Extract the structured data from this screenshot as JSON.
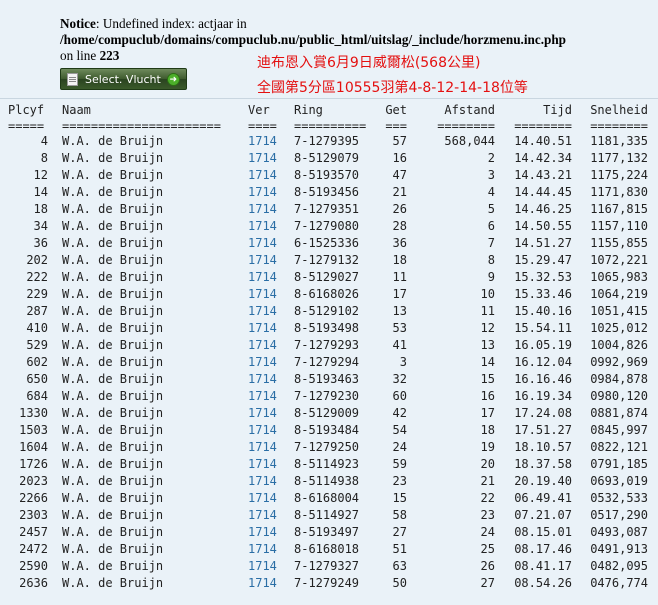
{
  "notice": {
    "label": "Notice",
    "message": ": Undefined index: actjaar in",
    "path": "/home/compuclub/domains/compuclub.nu/public_html/uitslag/_include/horzmenu.inc.php",
    "on_line": "on line",
    "line_no": "223"
  },
  "select_button": {
    "label": "Select. Vlucht"
  },
  "chinese": {
    "line1": "迪布恩入賞6月9日威爾松(568公里)",
    "line2": "全國第5分區10555羽第4-8-12-14-18位等"
  },
  "columns": [
    "Plcyf",
    "Naam",
    "Ver",
    "Ring",
    "Get",
    "Afstand",
    "Tijd",
    "Snelheid"
  ],
  "underlines": [
    "=====",
    "======================",
    "====",
    "==========",
    "===",
    "========",
    "========",
    "========"
  ],
  "rows": [
    [
      "4",
      "W.A. de Bruijn",
      "1714",
      "7-1279395",
      "57",
      "568,044",
      "14.40.51",
      "1181,335"
    ],
    [
      "8",
      "W.A. de Bruijn",
      "1714",
      "8-5129079",
      "16",
      "2",
      "14.42.34",
      "1177,132"
    ],
    [
      "12",
      "W.A. de Bruijn",
      "1714",
      "8-5193570",
      "47",
      "3",
      "14.43.21",
      "1175,224"
    ],
    [
      "14",
      "W.A. de Bruijn",
      "1714",
      "8-5193456",
      "21",
      "4",
      "14.44.45",
      "1171,830"
    ],
    [
      "18",
      "W.A. de Bruijn",
      "1714",
      "7-1279351",
      "26",
      "5",
      "14.46.25",
      "1167,815"
    ],
    [
      "34",
      "W.A. de Bruijn",
      "1714",
      "7-1279080",
      "28",
      "6",
      "14.50.55",
      "1157,110"
    ],
    [
      "36",
      "W.A. de Bruijn",
      "1714",
      "6-1525336",
      "36",
      "7",
      "14.51.27",
      "1155,855"
    ],
    [
      "202",
      "W.A. de Bruijn",
      "1714",
      "7-1279132",
      "18",
      "8",
      "15.29.47",
      "1072,221"
    ],
    [
      "222",
      "W.A. de Bruijn",
      "1714",
      "8-5129027",
      "11",
      "9",
      "15.32.53",
      "1065,983"
    ],
    [
      "229",
      "W.A. de Bruijn",
      "1714",
      "8-6168026",
      "17",
      "10",
      "15.33.46",
      "1064,219"
    ],
    [
      "287",
      "W.A. de Bruijn",
      "1714",
      "8-5129102",
      "13",
      "11",
      "15.40.16",
      "1051,415"
    ],
    [
      "410",
      "W.A. de Bruijn",
      "1714",
      "8-5193498",
      "53",
      "12",
      "15.54.11",
      "1025,012"
    ],
    [
      "529",
      "W.A. de Bruijn",
      "1714",
      "7-1279293",
      "41",
      "13",
      "16.05.19",
      "1004,826"
    ],
    [
      "602",
      "W.A. de Bruijn",
      "1714",
      "7-1279294",
      "3",
      "14",
      "16.12.04",
      "0992,969"
    ],
    [
      "650",
      "W.A. de Bruijn",
      "1714",
      "8-5193463",
      "32",
      "15",
      "16.16.46",
      "0984,878"
    ],
    [
      "684",
      "W.A. de Bruijn",
      "1714",
      "7-1279230",
      "60",
      "16",
      "16.19.34",
      "0980,120"
    ],
    [
      "1330",
      "W.A. de Bruijn",
      "1714",
      "8-5129009",
      "42",
      "17",
      "17.24.08",
      "0881,874"
    ],
    [
      "1503",
      "W.A. de Bruijn",
      "1714",
      "8-5193484",
      "54",
      "18",
      "17.51.27",
      "0845,997"
    ],
    [
      "1604",
      "W.A. de Bruijn",
      "1714",
      "7-1279250",
      "24",
      "19",
      "18.10.57",
      "0822,121"
    ],
    [
      "1726",
      "W.A. de Bruijn",
      "1714",
      "8-5114923",
      "59",
      "20",
      "18.37.58",
      "0791,185"
    ],
    [
      "2023",
      "W.A. de Bruijn",
      "1714",
      "8-5114938",
      "23",
      "21",
      "20.19.40",
      "0693,019"
    ],
    [
      "2266",
      "W.A. de Bruijn",
      "1714",
      "8-6168004",
      "15",
      "22",
      "06.49.41",
      "0532,533"
    ],
    [
      "2303",
      "W.A. de Bruijn",
      "1714",
      "8-5114927",
      "58",
      "23",
      "07.21.07",
      "0517,290"
    ],
    [
      "2457",
      "W.A. de Bruijn",
      "1714",
      "8-5193497",
      "27",
      "24",
      "08.15.01",
      "0493,087"
    ],
    [
      "2472",
      "W.A. de Bruijn",
      "1714",
      "8-6168018",
      "51",
      "25",
      "08.17.46",
      "0491,913"
    ],
    [
      "2590",
      "W.A. de Bruijn",
      "1714",
      "7-1279327",
      "63",
      "26",
      "08.41.17",
      "0482,095"
    ],
    [
      "2636",
      "W.A. de Bruijn",
      "1714",
      "7-1279249",
      "50",
      "27",
      "08.54.26",
      "0476,774"
    ]
  ]
}
